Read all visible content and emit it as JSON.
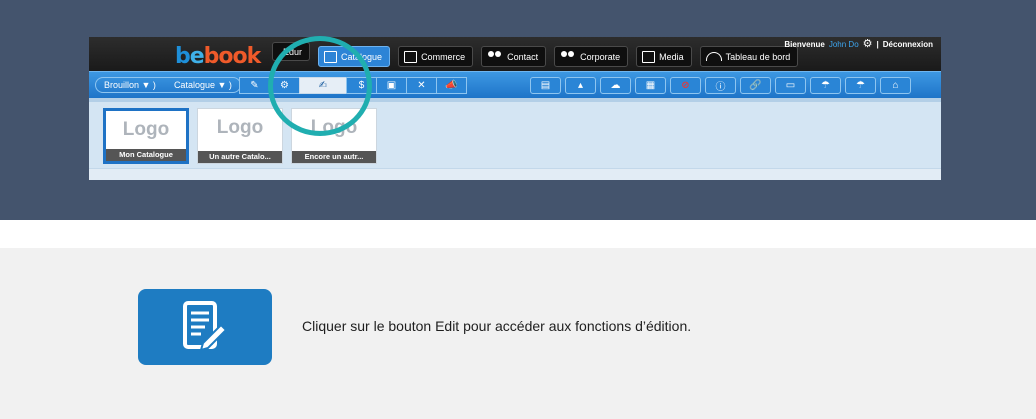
{
  "brand": {
    "b": "b",
    "e": "e",
    "rest": "book"
  },
  "top_nav": [
    {
      "label": "Edur",
      "icon": "none",
      "state": "partial"
    },
    {
      "label": "Catalogue",
      "icon": "catalogue-icon",
      "state": "active"
    },
    {
      "label": "Commerce",
      "icon": "commerce-edit-icon",
      "state": "normal"
    },
    {
      "label": "Contact",
      "icon": "people-icon",
      "state": "normal"
    },
    {
      "label": "Corporate",
      "icon": "corporate-people-icon",
      "state": "normal"
    },
    {
      "label": "Media",
      "icon": "image-icon",
      "state": "normal"
    },
    {
      "label": "Tableau de bord",
      "icon": "gauge-icon",
      "state": "normal"
    }
  ],
  "welcome": {
    "greeting": "Bienvenue",
    "user": "John Do",
    "separator": "|",
    "logout": "Déconnexion"
  },
  "breadcrumbs": [
    "Brouillon ▼ )",
    "Catalogue ▼ )"
  ],
  "toolbar": {
    "left_icons": [
      "✎",
      "⚙",
      "✍",
      "$",
      "▣",
      "✕",
      "📣"
    ],
    "right_icons": [
      "▤",
      "▴",
      "☁",
      "▦",
      "⊘",
      "ⓘ",
      "🔗",
      "▭",
      "☂",
      "☂",
      "⌂"
    ]
  },
  "catalogues": [
    {
      "logo": "Logo",
      "caption": "Mon Catalogue",
      "active": true
    },
    {
      "logo": "Logo",
      "caption": "Un autre Catalo...",
      "active": false
    },
    {
      "logo": "Logo",
      "caption": "Encore un autr...",
      "active": false
    }
  ],
  "instruction": "Cliquer sur le bouton Edit pour accéder aux fonctions d’édition.",
  "colors": {
    "accent": "#1e7cc2",
    "highlight_ring": "#20aeb0",
    "page_band": "#44546d"
  }
}
